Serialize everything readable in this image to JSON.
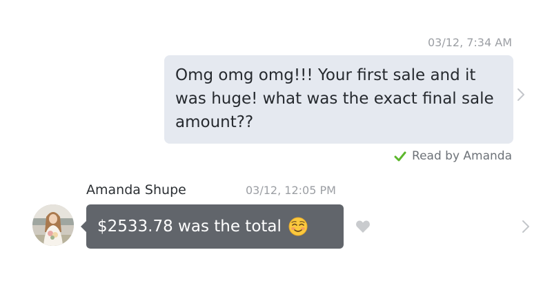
{
  "outgoing": {
    "timestamp": "03/12, 7:34 AM",
    "message": "Omg omg omg!!! Your first sale and it was huge! what was the exact final sale amount??",
    "read_receipt": "Read by Amanda"
  },
  "incoming": {
    "sender": "Amanda Shupe",
    "timestamp": "03/12, 12:05 PM",
    "message": "$2533.78 was the total",
    "emoji": "smiling-face-icon"
  },
  "icons": {
    "check": "check-icon",
    "heart": "heart-icon",
    "chevron": "chevron-right-icon"
  },
  "colors": {
    "outgoing_bubble": "#e5e9f0",
    "incoming_bubble": "#61656b",
    "check": "#5cb72c",
    "heart": "#c9cbce",
    "timestamp": "#9b9ea3"
  }
}
